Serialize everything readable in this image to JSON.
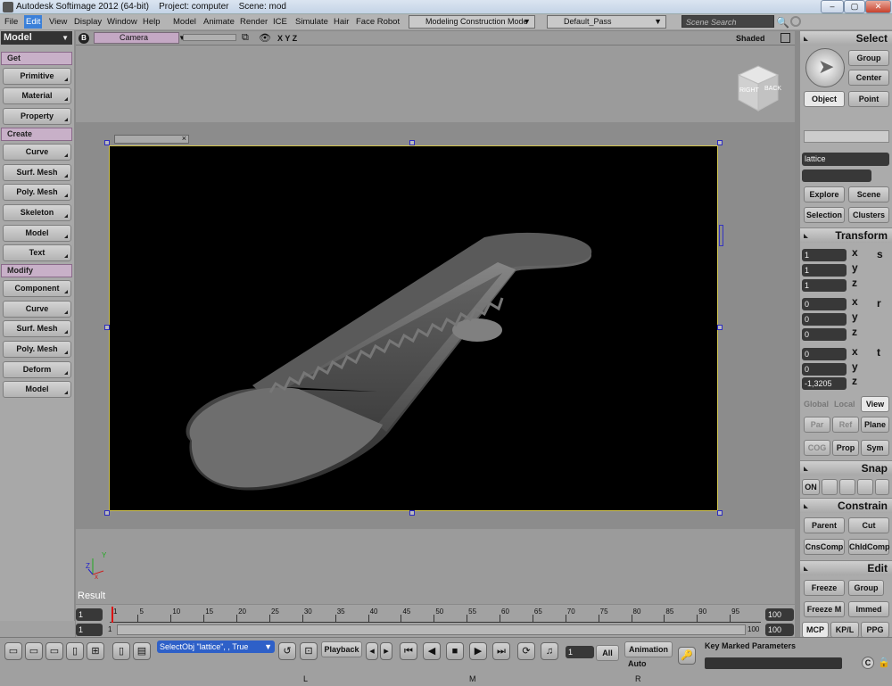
{
  "window": {
    "title": "Autodesk Softimage 2012 (64-bit)",
    "project": "Project: computer",
    "scene": "Scene: mod",
    "min": "–",
    "max": "▢",
    "close": "✕"
  },
  "menu": {
    "items": [
      "File",
      "Edit",
      "View",
      "Display",
      "Window",
      "Help",
      "Model",
      "Animate",
      "Render",
      "ICE",
      "Simulate",
      "Hair",
      "Face Robot"
    ],
    "active": "Edit",
    "mode": "Modeling Construction Mode",
    "pass": "Default_Pass",
    "search_placeholder": "Scene Search"
  },
  "left": {
    "module": "Model",
    "sections": [
      {
        "title": "Get",
        "buttons": [
          "Primitive",
          "Material",
          "Property"
        ]
      },
      {
        "title": "Create",
        "buttons": [
          "Curve",
          "Surf. Mesh",
          "Poly. Mesh",
          "Skeleton",
          "Model",
          "Text"
        ]
      },
      {
        "title": "Modify",
        "buttons": [
          "Component",
          "Curve",
          "Surf. Mesh",
          "Poly. Mesh",
          "Deform",
          "Model"
        ]
      }
    ]
  },
  "viewport": {
    "badge": "B",
    "camera": "Camera",
    "axes": "X Y Z",
    "shading": "Shaded",
    "result": "Result",
    "cube_right": "RIGHT",
    "cube_back": "BACK",
    "axis_x": "x",
    "axis_y": "Y",
    "axis_z": "Z"
  },
  "right": {
    "select": {
      "title": "Select",
      "group": "Group",
      "center": "Center",
      "object": "Object",
      "point": "Point",
      "name_field": "lattice",
      "explore": "Explore",
      "scene": "Scene",
      "selection": "Selection",
      "clusters": "Clusters"
    },
    "transform": {
      "title": "Transform",
      "scale": [
        "1",
        "1",
        "1"
      ],
      "rotate": [
        "0",
        "0",
        "0"
      ],
      "translate": [
        "0",
        "0",
        "-1,3205"
      ],
      "axes": [
        "x",
        "y",
        "z"
      ],
      "s_label": "s",
      "r_label": "r",
      "t_label": "t",
      "global": "Global",
      "local": "Local",
      "view": "View",
      "par": "Par",
      "ref": "Ref",
      "plane": "Plane",
      "cog": "COG",
      "prop": "Prop",
      "sym": "Sym"
    },
    "snap": {
      "title": "Snap",
      "on": "ON"
    },
    "constrain": {
      "title": "Constrain",
      "parent": "Parent",
      "cut": "Cut",
      "cnscomp": "CnsComp",
      "chldcomp": "ChldComp"
    },
    "edit": {
      "title": "Edit",
      "freeze": "Freeze",
      "group": "Group",
      "freezem": "Freeze M",
      "immed": "Immed"
    },
    "tabs": [
      "MCP",
      "KP/L",
      "PPG"
    ]
  },
  "timeline": {
    "start": "1",
    "end": "100",
    "current": "1",
    "range_start": "1",
    "range_end": "100",
    "end2": "100",
    "ticks": [
      "1",
      "5",
      "10",
      "15",
      "20",
      "25",
      "30",
      "35",
      "40",
      "45",
      "50",
      "55",
      "60",
      "65",
      "70",
      "75",
      "80",
      "85",
      "90",
      "95"
    ]
  },
  "bottom": {
    "command": "SelectObj \"lattice\", , True",
    "playback": "Playback",
    "frame": "1",
    "all": "All",
    "animation": "Animation",
    "auto": "Auto",
    "keymarked": "Key Marked Parameters",
    "markers": [
      "L",
      "M",
      "R"
    ]
  }
}
